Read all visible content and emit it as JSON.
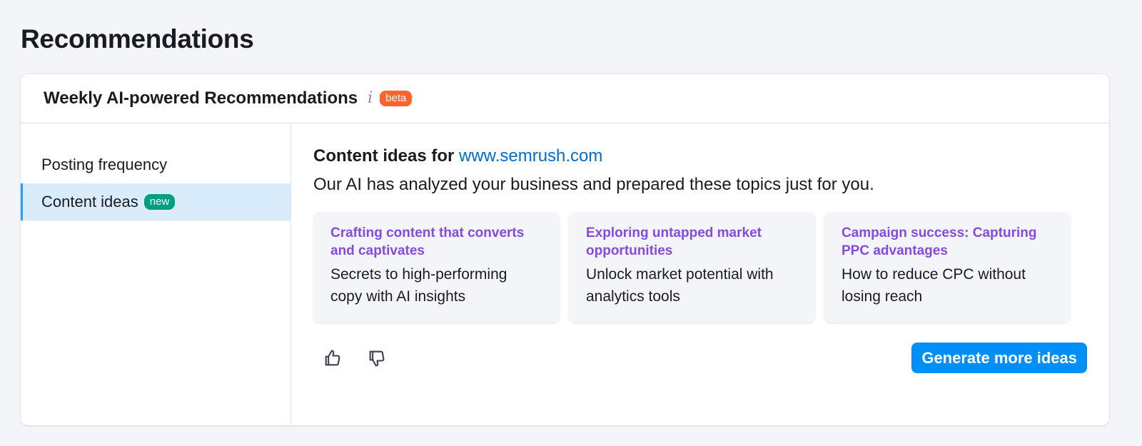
{
  "page": {
    "title": "Recommendations"
  },
  "card": {
    "title": "Weekly AI-powered Recommendations",
    "info_icon": "i",
    "beta_label": "beta"
  },
  "sidebar": {
    "items": [
      {
        "label": "Posting frequency",
        "active": false
      },
      {
        "label": "Content ideas",
        "badge": "new",
        "active": true
      }
    ]
  },
  "main": {
    "title_prefix": "Content ideas for",
    "domain": "www.semrush.com",
    "subtitle": "Our AI has analyzed your business and prepared these topics just for you.",
    "ideas": [
      {
        "title": "Crafting content that converts and captivates",
        "text": "Secrets to high-performing copy with AI insights"
      },
      {
        "title": "Exploring untapped market opportunities",
        "text": "Unlock market potential with analytics tools"
      },
      {
        "title": "Campaign success: Capturing PPC advantages",
        "text": "How to reduce CPC without losing reach"
      }
    ],
    "generate_label": "Generate more ideas"
  },
  "icons": {
    "like": "thumbs-up-icon",
    "dislike": "thumbs-down-icon"
  },
  "colors": {
    "accent": "#008ff8",
    "beta": "#ff642d",
    "new": "#009f81",
    "idea_title": "#8649e1",
    "link": "#006dca"
  }
}
